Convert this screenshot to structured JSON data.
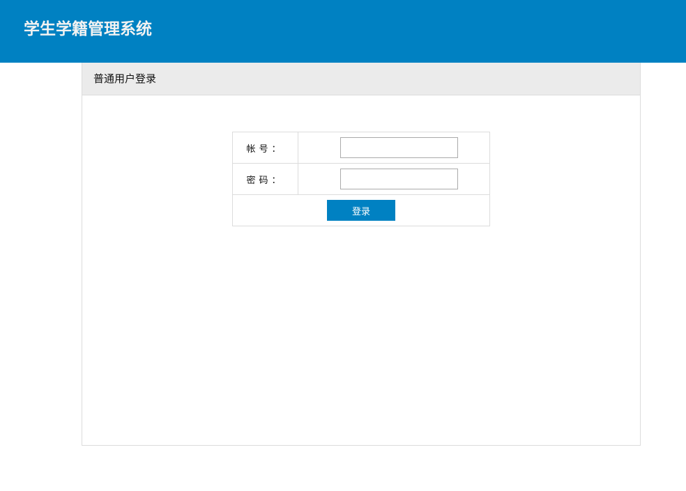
{
  "header": {
    "title": "学生学籍管理系统"
  },
  "panel": {
    "title": "普通用户登录"
  },
  "form": {
    "account_label": "帐号：",
    "account_value": "",
    "password_label": "密码：",
    "password_value": "",
    "submit_label": "登录"
  },
  "colors": {
    "brand": "#0081c2",
    "panel_header": "#ebebeb"
  }
}
